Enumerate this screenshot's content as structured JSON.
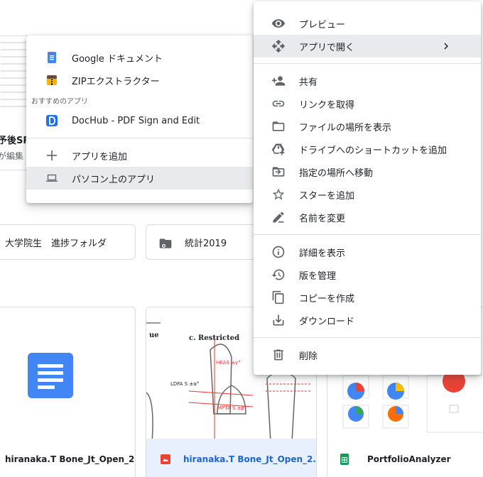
{
  "background": {
    "top_card": {
      "title_fragment": "予後SR,",
      "subtitle_fragment": "が編集"
    },
    "folders": [
      {
        "name": "大学院生　進捗フォルダ",
        "icon": "folder-icon"
      },
      {
        "name": "統計2019",
        "icon": "shared-folder-icon"
      }
    ],
    "files": [
      {
        "name": "hiranaka.T Bone_Jt_Open_2...",
        "icon": "google-docs-icon"
      },
      {
        "name": "hiranaka.T Bone_Jt_Open_2...",
        "icon": "image-file-icon",
        "selected": true,
        "thumb_text": "c. Restricted",
        "thumb_text_left": "ue",
        "thumb_labels": [
          "HKAS ±γ°",
          "LDFA S ±α°",
          "MPTA S ±β°"
        ]
      },
      {
        "name": "PortfolioAnalyzer",
        "icon": "google-sheets-icon"
      }
    ]
  },
  "open_with_menu": {
    "apps": [
      {
        "label": "Google ドキュメント",
        "icon": "google-docs-icon"
      },
      {
        "label": "ZIPエクストラクター",
        "icon": "zip-extractor-icon"
      }
    ],
    "suggested_header": "おすすめのアプリ",
    "suggested": [
      {
        "label": "DocHub - PDF Sign and Edit",
        "icon": "dochub-icon"
      }
    ],
    "actions": [
      {
        "label": "アプリを追加",
        "icon": "plus-icon"
      },
      {
        "label": "パソコン上のアプリ",
        "icon": "laptop-icon",
        "highlighted": true
      }
    ]
  },
  "context_menu": {
    "group1": [
      {
        "label": "プレビュー",
        "icon": "eye-icon"
      },
      {
        "label": "アプリで開く",
        "icon": "move-arrows-icon",
        "highlighted": true,
        "has_submenu": true
      }
    ],
    "group2": [
      {
        "label": "共有",
        "icon": "add-person-icon"
      },
      {
        "label": "リンクを取得",
        "icon": "link-icon"
      },
      {
        "label": "ファイルの場所を表示",
        "icon": "folder-outline-icon"
      },
      {
        "label": "ドライブへのショートカットを追加",
        "icon": "drive-shortcut-icon"
      },
      {
        "label": "指定の場所へ移動",
        "icon": "move-to-folder-icon"
      },
      {
        "label": "スターを追加",
        "icon": "star-outline-icon"
      },
      {
        "label": "名前を変更",
        "icon": "pencil-icon"
      }
    ],
    "group3": [
      {
        "label": "詳細を表示",
        "icon": "info-icon"
      },
      {
        "label": "版を管理",
        "icon": "history-icon"
      },
      {
        "label": "コピーを作成",
        "icon": "copy-icon"
      },
      {
        "label": "ダウンロード",
        "icon": "download-icon"
      }
    ],
    "group4": [
      {
        "label": "削除",
        "icon": "trash-icon"
      }
    ]
  },
  "colors": {
    "docs_blue": "#4285f4",
    "sheets_green": "#0f9d58",
    "image_red": "#ea4335",
    "highlight": "#e8eaed",
    "selected_bg": "#e8f0fe",
    "selected_text": "#1967d2"
  }
}
